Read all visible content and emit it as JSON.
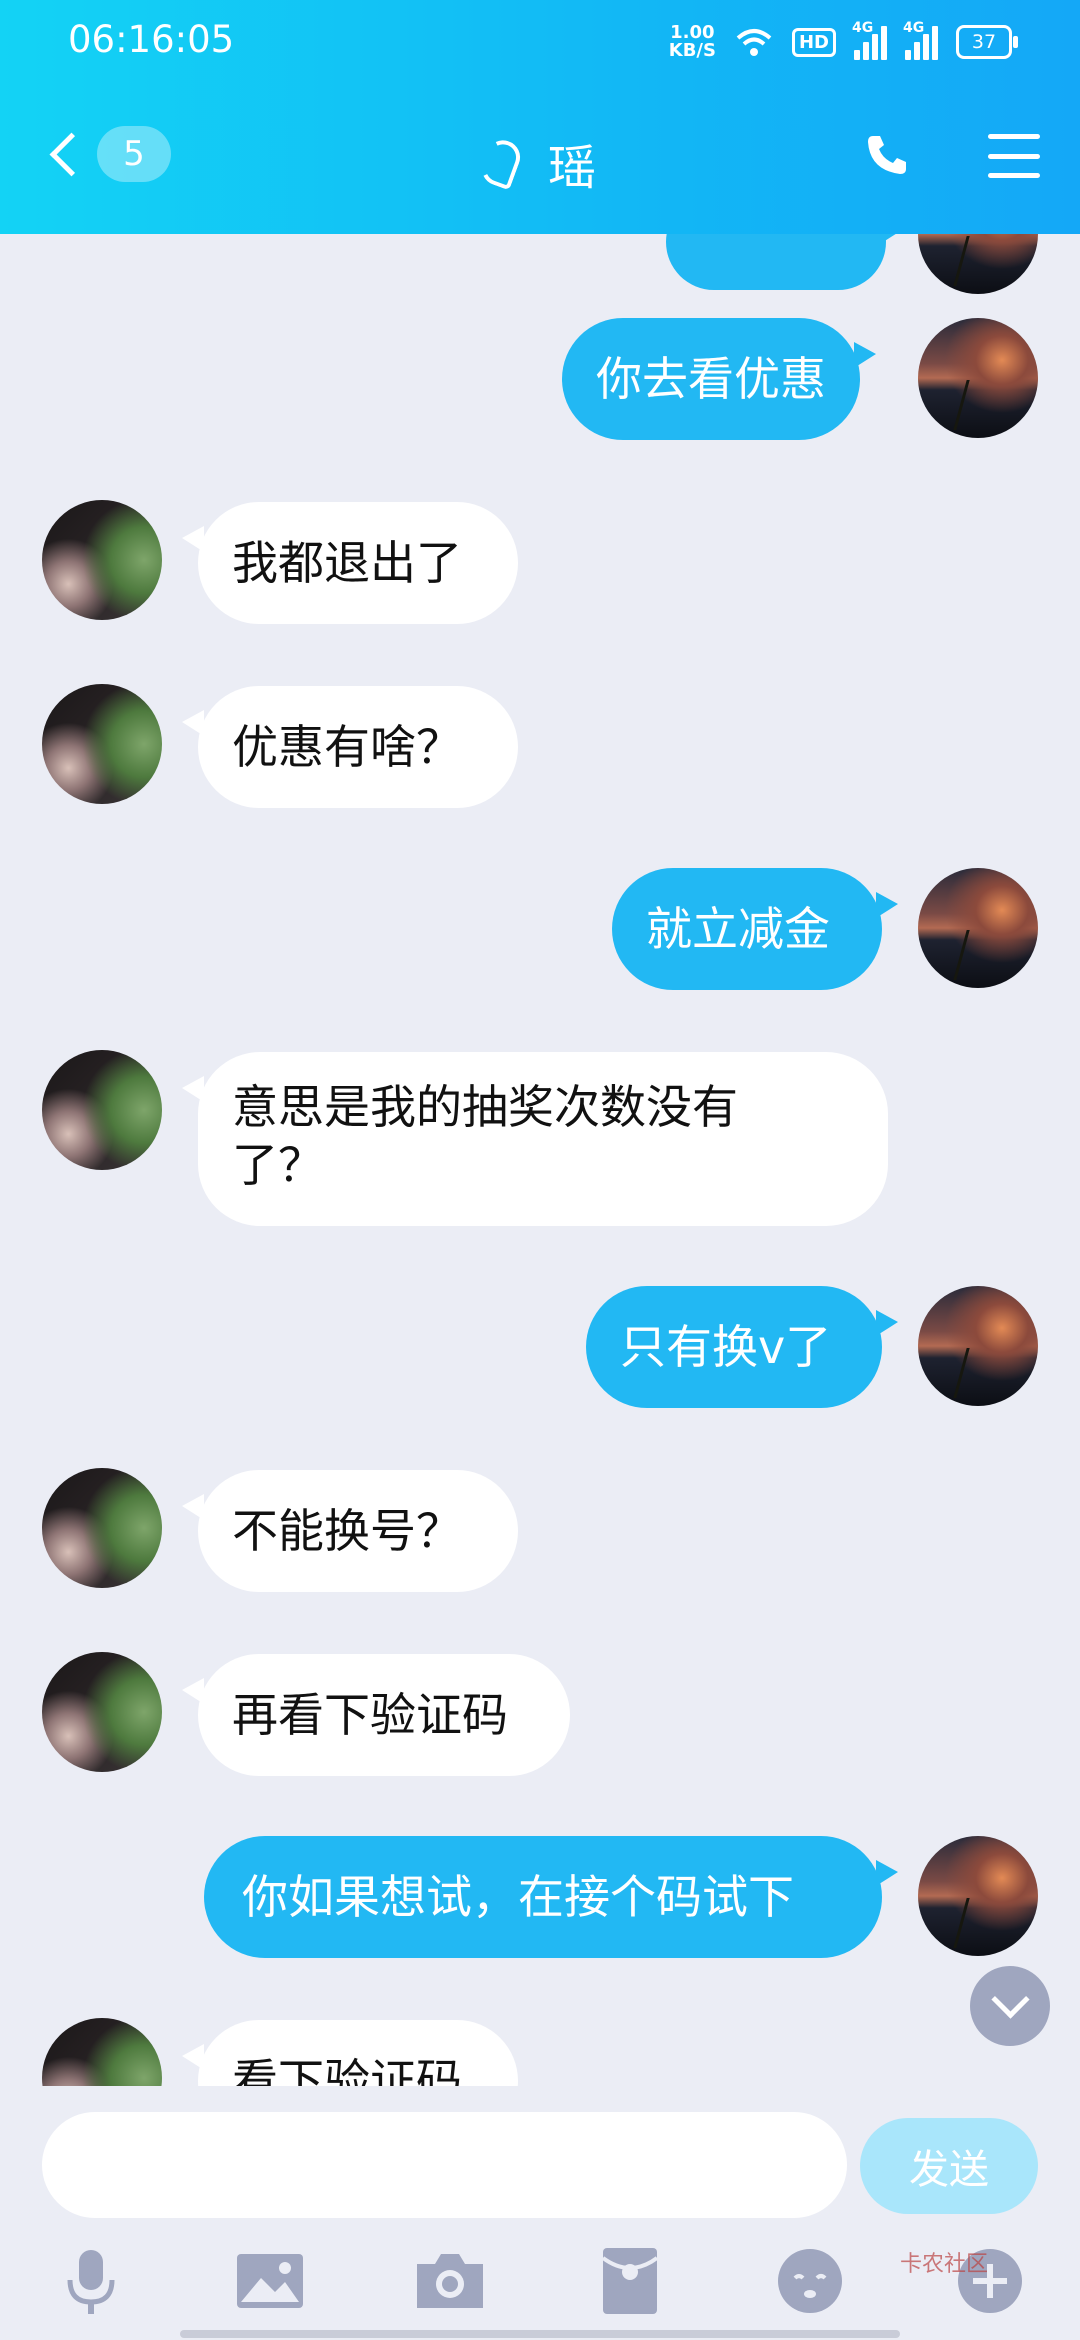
{
  "status_bar": {
    "time": "06:16:05",
    "net_speed_value": "1.00",
    "net_speed_unit": "KB/S",
    "hd_badge": "HD",
    "signal_1": "4G",
    "signal_2": "4G",
    "battery": "37"
  },
  "header": {
    "unread_count": "5",
    "contact_name": "瑶"
  },
  "messages": [
    {
      "from": "self",
      "text": "你去看优惠"
    },
    {
      "from": "other",
      "text": "我都退出了"
    },
    {
      "from": "other",
      "text": "优惠有啥？"
    },
    {
      "from": "self",
      "text": "就立减金"
    },
    {
      "from": "other",
      "text": "意思是我的抽奖次数没有了？"
    },
    {
      "from": "self",
      "text": "只有换v了"
    },
    {
      "from": "other",
      "text": "不能换号？"
    },
    {
      "from": "other",
      "text": "再看下验证码"
    },
    {
      "from": "self",
      "text": "你如果想试，在接个码试下"
    },
    {
      "from": "other",
      "text": "看下验证码"
    }
  ],
  "input": {
    "value": "",
    "send_label": "发送"
  },
  "toolbar": {
    "icons": [
      "microphone-icon",
      "image-icon",
      "camera-icon",
      "red-packet-icon",
      "emoji-icon",
      "more-icon"
    ]
  },
  "watermark": "卡农社区",
  "colors": {
    "header": "#12B7F5",
    "self_bubble": "#22B8F3",
    "other_bubble": "#FFFFFF",
    "background": "#EBEDF5",
    "send_disabled": "#A9E6FB"
  }
}
